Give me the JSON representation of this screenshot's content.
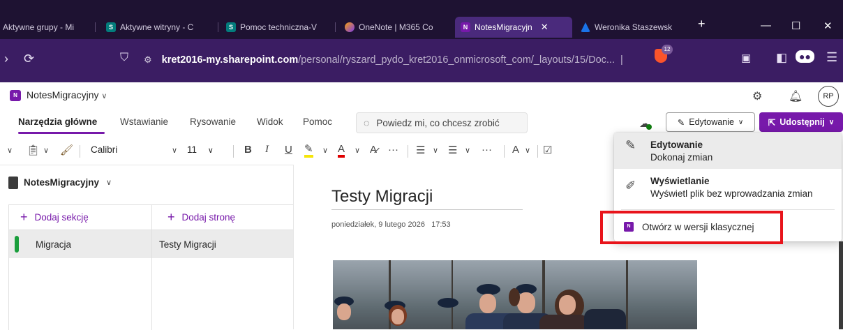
{
  "browser": {
    "tabs": [
      {
        "label": "Aktywne grupy - Mi",
        "icon": "none"
      },
      {
        "label": "Aktywne witryny - C",
        "icon": "sharepoint-icon"
      },
      {
        "label": "Pomoc techniczna-V",
        "icon": "sharepoint-icon"
      },
      {
        "label": "OneNote | M365 Co",
        "icon": "onenote-icon"
      },
      {
        "label": "NotesMigracyjn",
        "icon": "onenote-icon",
        "active": true
      },
      {
        "label": "Weronika Staszewsk",
        "icon": "azure-icon"
      }
    ],
    "new_tab": "+",
    "url_host": "kret2016-my.sharepoint.com",
    "url_path": "/personal/ryszard_pydo_kret2016_onmicrosoft_com/_layouts/15/Doc...",
    "shield_count": "12"
  },
  "app": {
    "notebook_name": "NotesMigracyjny",
    "avatar_initials": "RP",
    "ribbon_tabs": [
      "Narzędzia główne",
      "Wstawianie",
      "Rysowanie",
      "Widok",
      "Pomoc"
    ],
    "tell_me_placeholder": "Powiedz mi, co chcesz zrobić",
    "edit_mode_label": "Edytowanie",
    "share_label": "Udostępnij",
    "font_name": "Calibri",
    "font_size": "11"
  },
  "nav": {
    "notebook_title": "NotesMigracyjny",
    "add_section": "Dodaj sekcję",
    "add_page": "Dodaj stronę",
    "sections": [
      {
        "label": "Migracja",
        "color": "#1a9e3c"
      }
    ],
    "pages": [
      {
        "label": "Testy Migracji"
      }
    ]
  },
  "page": {
    "title": "Testy Migracji",
    "date": "poniedziałek, 9 lutego 2026",
    "time": "17:53"
  },
  "menu": {
    "items": [
      {
        "title": "Edytowanie",
        "desc": "Dokonaj zmian",
        "icon": "pen-icon"
      },
      {
        "title": "Wyświetlanie",
        "desc": "Wyświetl plik bez wprowadzania zmian",
        "icon": "pen-off-icon"
      }
    ],
    "open_desktop": "Otwórz w wersji klasycznej"
  },
  "colors": {
    "accent": "#7719aa",
    "highlight_box": "#e8141b",
    "section_color": "#1a9e3c"
  }
}
